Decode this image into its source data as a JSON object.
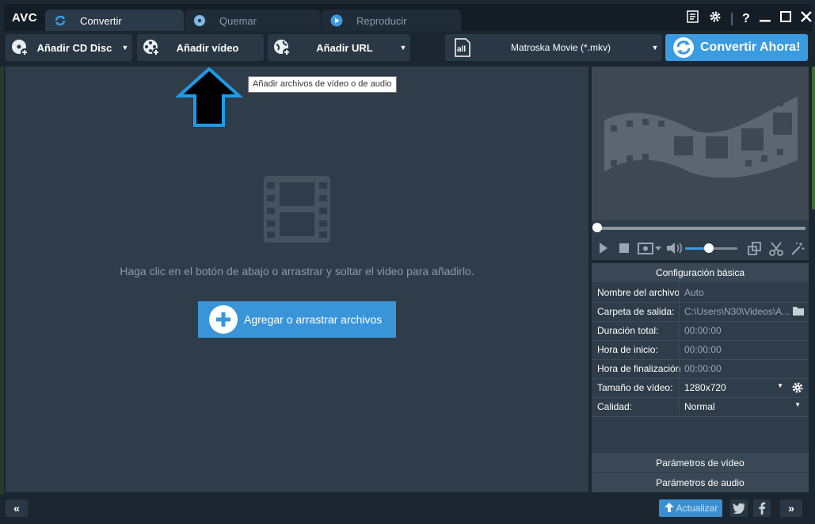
{
  "app": {
    "logo": "AVC"
  },
  "tabs": [
    {
      "label": "Convertir",
      "icon": "convert-icon"
    },
    {
      "label": "Quemar",
      "icon": "disc-burn-icon"
    },
    {
      "label": "Reproducir",
      "icon": "play-icon"
    }
  ],
  "window_controls": [
    "menu-icon",
    "settings-icon",
    "help-icon",
    "minimize-icon",
    "maximize-icon",
    "close-icon"
  ],
  "toolbar": {
    "add_cd_label": "Añadir CD Disc",
    "add_video_label": "Añadir vídeo",
    "add_url_label": "Añadir URL",
    "format_label": "Matroska Movie (*.mkv)",
    "convert_label": "Convertir Ahora!"
  },
  "tooltip": "Añadir archivos de vídeo o de audio",
  "main": {
    "hint": "Haga clic en el botón de abajo o arrastrar y soltar el video para añadirlo.",
    "add_files_label": "Agregar o arrastrar archivos"
  },
  "settings": {
    "title": "Configuración básica",
    "rows": [
      {
        "label": "Nombre del archivo",
        "value": "Auto"
      },
      {
        "label": "Carpeta de salida:",
        "value": "C:\\Users\\N30\\Videos\\A..."
      },
      {
        "label": "Duración total:",
        "value": "00:00:00"
      },
      {
        "label": "Hora de inicio:",
        "value": "00:00:00"
      },
      {
        "label": "Hora de finalización",
        "value": "00:00:00"
      },
      {
        "label": "Tamaño de vídeo:",
        "value": "1280x720"
      },
      {
        "label": "Calidad:",
        "value": "Normal"
      }
    ],
    "video_params": "Parámetros de vídeo",
    "audio_params": "Parámetros de audio"
  },
  "player": {
    "seek_position": 0.0,
    "volume": 0.45
  },
  "bottom": {
    "update_label": "Actualizar"
  },
  "colors": {
    "accent": "#3a9be0",
    "panel": "#2f3c49",
    "arrow_outline": "#1e9be8"
  }
}
